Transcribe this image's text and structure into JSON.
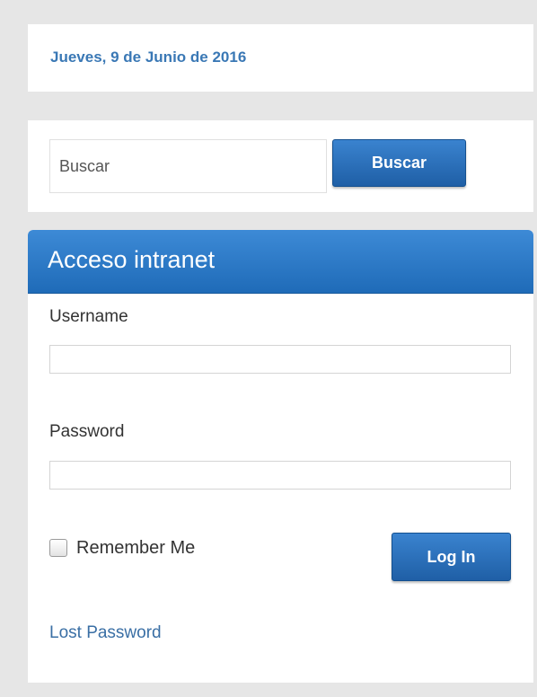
{
  "date_panel": {
    "date_text": "Jueves, 9 de Junio de 2016"
  },
  "search": {
    "placeholder": "Buscar",
    "button_label": "Buscar"
  },
  "login": {
    "title": "Acceso intranet",
    "username_label": "Username",
    "password_label": "Password",
    "remember_label": "Remember Me",
    "remember_checked": false,
    "login_button_label": "Log In",
    "lost_password_label": "Lost Password"
  },
  "colors": {
    "page_background": "#e6e6e6",
    "accent_blue": "#2a72bf",
    "link_blue": "#3a6fa5",
    "date_blue": "#3a78b5"
  },
  "icons": {
    "checkbox": "checkbox-icon"
  }
}
